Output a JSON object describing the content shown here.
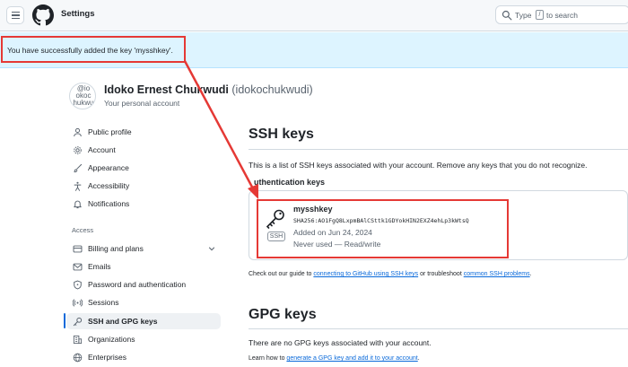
{
  "header": {
    "title": "Settings",
    "search": {
      "prefix": "Type",
      "key": "/",
      "suffix": "to search"
    }
  },
  "flash": {
    "message": "You have successfully added the key 'mysshkey'."
  },
  "user": {
    "avatar_alt": "@idokochukwudi",
    "name": "Idoko Ernest Chukwudi",
    "handle": "(idokochukwudi)",
    "subtitle": "Your personal account"
  },
  "sidebar": {
    "items": [
      {
        "label": "Public profile",
        "icon": "person-icon"
      },
      {
        "label": "Account",
        "icon": "gear-icon"
      },
      {
        "label": "Appearance",
        "icon": "paintbrush-icon"
      },
      {
        "label": "Accessibility",
        "icon": "accessibility-icon"
      },
      {
        "label": "Notifications",
        "icon": "bell-icon"
      }
    ],
    "access_heading": "Access",
    "access_items": [
      {
        "label": "Billing and plans",
        "icon": "credit-card-icon"
      },
      {
        "label": "Emails",
        "icon": "mail-icon"
      },
      {
        "label": "Password and authentication",
        "icon": "shield-lock-icon"
      },
      {
        "label": "Sessions",
        "icon": "broadcast-icon"
      },
      {
        "label": "SSH and GPG keys",
        "icon": "key-icon"
      },
      {
        "label": "Organizations",
        "icon": "organization-icon"
      },
      {
        "label": "Enterprises",
        "icon": "globe-icon"
      }
    ]
  },
  "main": {
    "ssh_title": "SSH keys",
    "ssh_desc": "This is a list of SSH keys associated with your account. Remove any keys that you do not recognize.",
    "auth_heading": "uthentication keys",
    "key": {
      "name": "mysshkey",
      "fingerprint": "SHA256:AO1FgQ8LxpmBAlCSttk1GDYokHIN2EXZ4ehLp3kWtsQ",
      "added": "Added on Jun 24, 2024",
      "usage": "Never used — Read/write",
      "badge": "SSH"
    },
    "guide": {
      "pre": "Check out our guide to ",
      "link1": "connecting to GitHub using SSH keys",
      "mid": " or troubleshoot ",
      "link2": "common SSH problems",
      "post": "."
    },
    "gpg_title": "GPG keys",
    "gpg_none": "There are no GPG keys associated with your account.",
    "gpg_learn": {
      "pre": "Learn how to ",
      "link": "generate a GPG key and add it to your account",
      "post": "."
    }
  },
  "colors": {
    "accent": "#0969da",
    "highlight": "#e53935",
    "flash_bg": "#ddf4ff"
  }
}
